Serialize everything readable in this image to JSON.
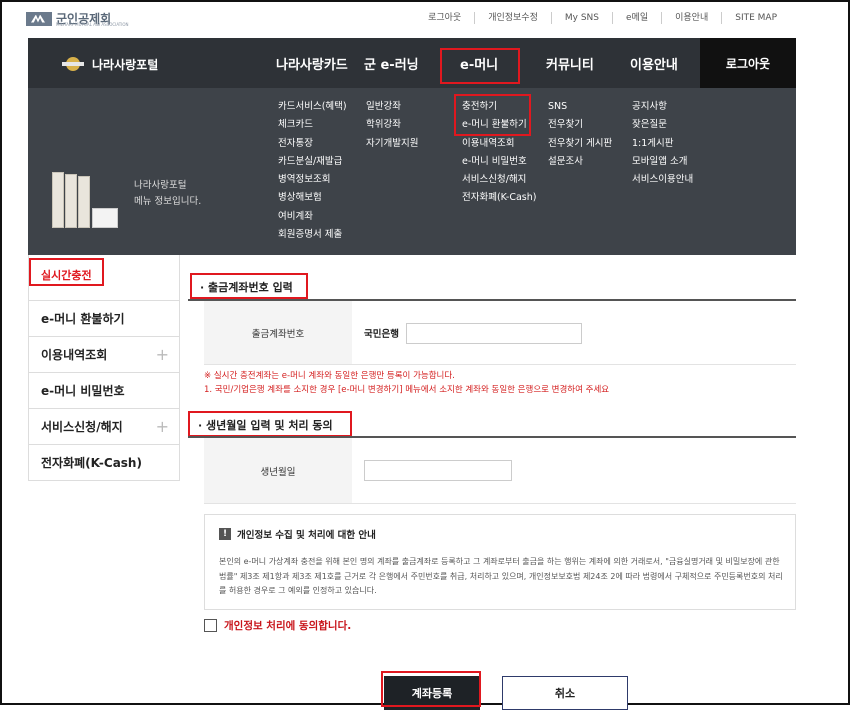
{
  "site": {
    "logo_text": "군인공제회",
    "logo_sub": "MILITARY MUTUAL AID ASSOCIATION"
  },
  "util_links": [
    "로그아웃",
    "개인정보수정",
    "My SNS",
    "e메일",
    "이용안내",
    "SITE MAP"
  ],
  "gnb": {
    "portal_title": "나라사랑포털",
    "menus": [
      "나라사랑카드",
      "군 e-러닝",
      "e-머니",
      "커뮤니티",
      "이용안내"
    ],
    "logout": "로그아웃",
    "submenus": [
      [
        "카드서비스(혜택)",
        "체크카드",
        "전자통장",
        "카드분실/재발급",
        "병역정보조회",
        "병상해보험",
        "여비계좌",
        "회원증명서 제출"
      ],
      [
        "일반강좌",
        "학위강좌",
        "자기개발지원"
      ],
      [
        "충전하기",
        "e-머니 환불하기",
        "이용내역조회",
        "e-머니 비밀번호",
        "서비스신청/해지",
        "전자화폐(K-Cash)"
      ],
      [
        "SNS",
        "전우찾기",
        "전우찾기 게시판",
        "설문조사"
      ],
      [
        "공지사항",
        "잦은질문",
        "1:1게시판",
        "모바일앱 소개",
        "서비스이용안내"
      ]
    ],
    "promo": [
      "나라사랑포털",
      "메뉴 정보입니다."
    ]
  },
  "lnb": {
    "items": [
      "실시간충전",
      "e-머니 환불하기",
      "이용내역조회",
      "e-머니 비밀번호",
      "서비스신청/해지",
      "전자화폐(K-Cash)"
    ]
  },
  "account_section": {
    "title": "출금계좌번호 입력",
    "label": "출금계좌번호",
    "bank": "국민은행",
    "account_value": "",
    "note1": "※ 실시간 충전계좌는 e-머니 계좌와 동일한 은행만 등록이 가능합니다.",
    "note2": "1. 국민/기업은행 계좌를 소지한 경우 [e-머니 변경하기] 메뉴에서 소지한 계좌와 동일한 은행으로 변경하여 주세요"
  },
  "birth_section": {
    "title": "생년월일 입력 및 처리 동의",
    "label": "생년월일",
    "birth_value": ""
  },
  "privacy": {
    "title": "개인정보 수집 및 처리에 대한 안내",
    "body": "본인의 e-머니 가상계좌 충전을 위해 본인 명의 계좌를 출금계좌로 등록하고 그 계좌로부터 출금을 하는 행위는 계좌에 의한 거래로서, \"금융실명거래 및 비밀보장에 관한 법률\" 제3조 제1항과 제3조 제1호를 근거로 각 은행에서 주민번호를 취급, 처리하고 있으며, 개인정보보호법 제24조 2에 따라 법령에서 구체적으로 주민등록번호의 처리를 허용한 경우로 그 예외를 인정하고 있습니다.",
    "agree_label": "개인정보 처리에 동의합니다."
  },
  "buttons": {
    "submit": "계좌등록",
    "cancel": "취소"
  },
  "colors": {
    "highlight": "#e0181f",
    "gnb_bg": "#3e4349",
    "button_dark": "#1e2226"
  }
}
